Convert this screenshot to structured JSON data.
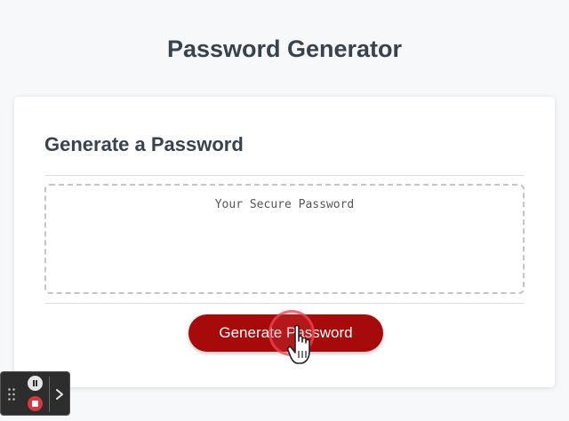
{
  "header": {
    "title": "Password Generator"
  },
  "card": {
    "title": "Generate a Password",
    "password": {
      "placeholder": "Your Secure Password",
      "value": ""
    },
    "generate_button_label": "Generate Password"
  },
  "colors": {
    "accent": "#a70a0a",
    "background": "#f7f8f9",
    "card": "#ffffff",
    "text": "#39434e",
    "recorder_stop": "#d9363e"
  },
  "icons": {
    "cursor": "hand-pointer-icon",
    "recorder_pause": "pause-icon",
    "recorder_stop": "stop-icon",
    "recorder_grip": "drag-grip-icon",
    "recorder_expand": "chevron-right-icon"
  }
}
